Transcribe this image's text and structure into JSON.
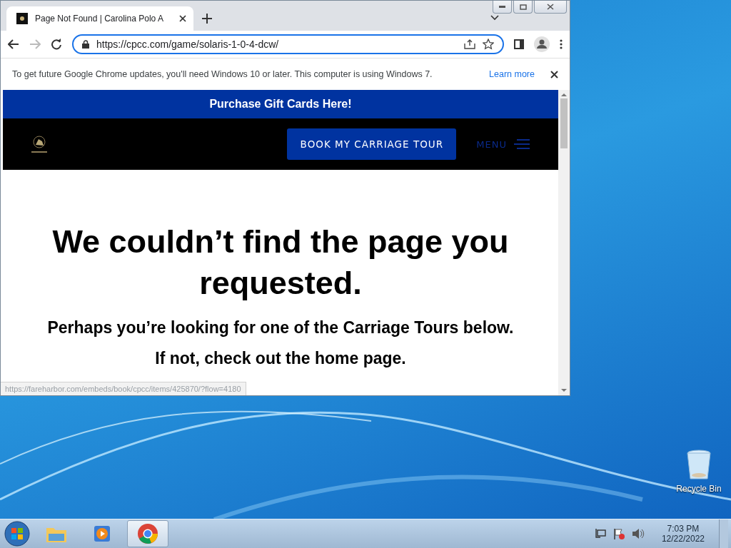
{
  "window": {
    "tab": {
      "title": "Page Not Found | Carolina Polo A",
      "selected": true
    },
    "address": {
      "url": "https://cpcc.com/game/solaris-1-0-4-dcw/"
    },
    "infobar": {
      "message": "To get future Google Chrome updates, you'll need Windows 10 or later. This computer is using Windows 7.",
      "link": "Learn more"
    },
    "page": {
      "banner": "Purchase Gift Cards Here!",
      "nav_button": "BOOK MY CARRIAGE TOUR",
      "menu": "MENU",
      "heading": "We couldn’t find the page you requested.",
      "subheading": "Perhaps you’re looking for one of the Carriage Tours below.",
      "note": "If not, check out the home page."
    },
    "status_url": "https://fareharbor.com/embeds/book/cpcc/items/425870/?flow=4180"
  },
  "desktop_icons": [
    {
      "label": "Recycle Bin"
    }
  ],
  "taskbar": {
    "apps": [
      {
        "kind": "explorer",
        "selected": false
      },
      {
        "kind": "media",
        "selected": false
      },
      {
        "kind": "chrome",
        "selected": true
      }
    ],
    "clock": {
      "time": "7:03 PM",
      "date": "12/22/2022"
    }
  }
}
